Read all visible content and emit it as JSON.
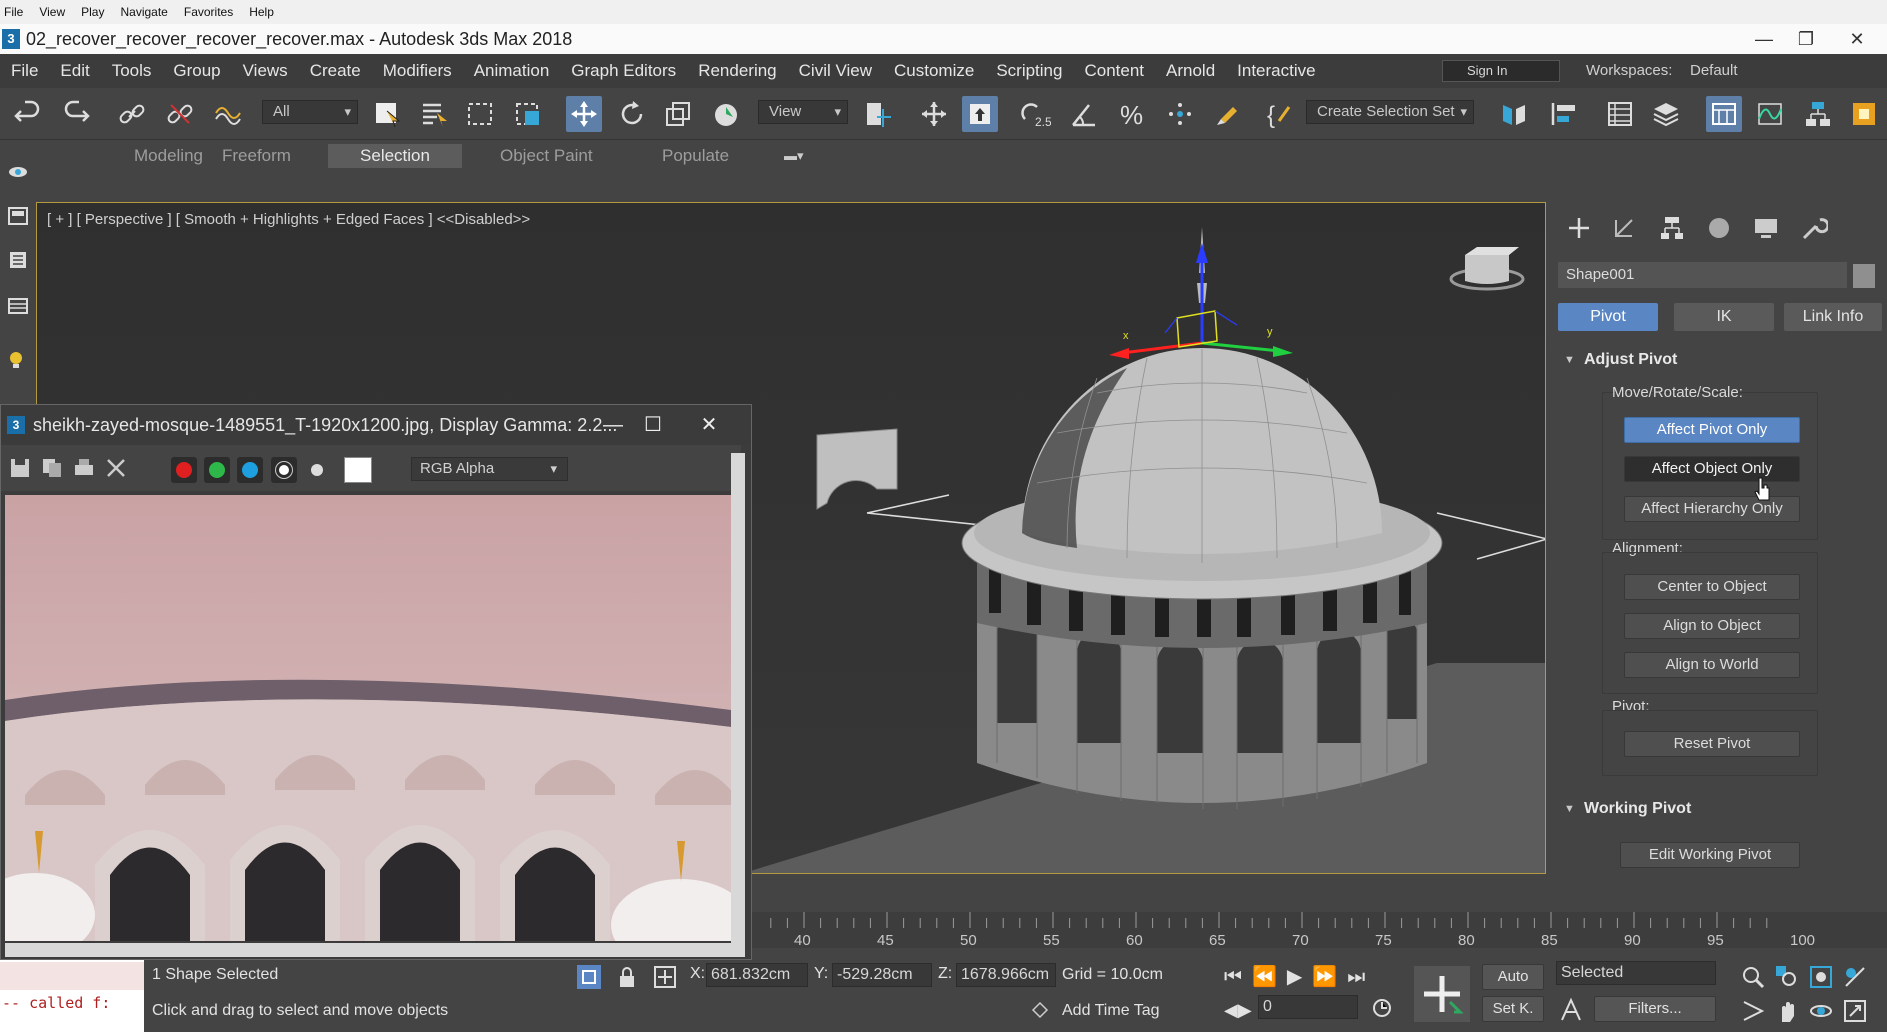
{
  "system_menu": [
    "File",
    "View",
    "Play",
    "Navigate",
    "Favorites",
    "Help"
  ],
  "window": {
    "title": "02_recover_recover_recover_recover.max - Autodesk 3ds Max 2018",
    "app_badge": "3"
  },
  "main_menu": [
    "File",
    "Edit",
    "Tools",
    "Group",
    "Views",
    "Create",
    "Modifiers",
    "Animation",
    "Graph Editors",
    "Rendering",
    "Civil View",
    "Customize",
    "Scripting",
    "Content",
    "Arnold",
    "Interactive"
  ],
  "account": {
    "sign_in": "Sign In"
  },
  "workspaces": {
    "label": "Workspaces:",
    "value": "Default"
  },
  "toolbar": {
    "filter_value": "All",
    "ref_coord_value": "View",
    "selection_set_value": "Create Selection Set",
    "snap_label": "2.5"
  },
  "ribbon_tabs": [
    {
      "label": "Modeling"
    },
    {
      "label": "Freeform"
    },
    {
      "label": "Selection",
      "active": true
    },
    {
      "label": "Object Paint"
    },
    {
      "label": "Populate"
    }
  ],
  "viewport": {
    "label": "[ + ] [ Perspective ]  [ Smooth + Highlights + Edged Faces ] <<Disabled>>",
    "gizmo_axes": [
      "x",
      "y"
    ]
  },
  "command_panel": {
    "object_name": "Shape001",
    "sub_tabs": [
      {
        "label": "Pivot",
        "active": true
      },
      {
        "label": "IK"
      },
      {
        "label": "Link Info"
      }
    ],
    "adjust_pivot": {
      "title": "Adjust Pivot",
      "move_group_label": "Move/Rotate/Scale:",
      "affect_pivot_only": "Affect Pivot Only",
      "affect_object_only": "Affect Object Only",
      "affect_hierarchy_only": "Affect Hierarchy Only",
      "alignment_label": "Alignment:",
      "center_to_object": "Center to Object",
      "align_to_object": "Align to Object",
      "align_to_world": "Align to World",
      "pivot_label": "Pivot:",
      "reset_pivot": "Reset Pivot"
    },
    "working_pivot": {
      "title": "Working Pivot",
      "edit_working_pivot": "Edit Working Pivot"
    }
  },
  "image_viewer": {
    "title": "sheikh-zayed-mosque-1489551_T-1920x1200.jpg, Display Gamma: 2.2...",
    "channel_value": "RGB Alpha",
    "channel_colors": {
      "red": "#e02020",
      "green": "#2fb84a",
      "blue": "#1ea0e0"
    }
  },
  "time_slider": {
    "ticks": [
      "40",
      "45",
      "50",
      "55",
      "60",
      "65",
      "70",
      "75",
      "80",
      "85",
      "90",
      "95",
      "100"
    ]
  },
  "status": {
    "maxscript_line": "-- called f:",
    "selection_count": "1 Shape Selected",
    "prompt": "Click and drag to select and move objects",
    "x_label": "X:",
    "x_value": "681.832cm",
    "y_label": "Y:",
    "y_value": "-529.28cm",
    "z_label": "Z:",
    "z_value": "1678.966cm",
    "grid": "Grid = 10.0cm",
    "add_time_tag": "Add Time Tag",
    "auto_key": "Auto",
    "set_key": "Set K.",
    "selected_dropdown": "Selected",
    "filters": "Filters...",
    "frame_value": "0"
  },
  "colors": {
    "accent_blue": "#5a86c4",
    "viewport_border": "#b39a3f",
    "panel_bg": "#444444"
  }
}
